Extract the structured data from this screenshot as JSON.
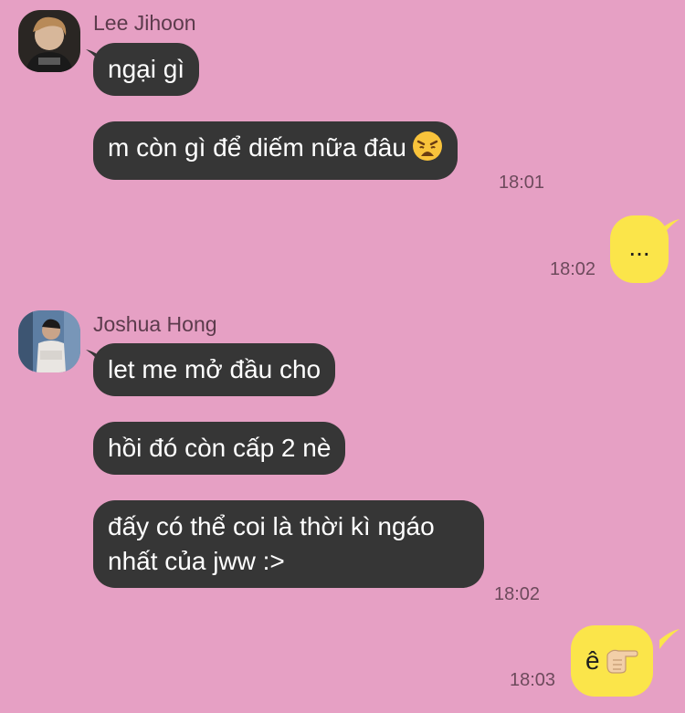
{
  "colors": {
    "background": "#e6a0c4",
    "incoming_bubble": "#363636",
    "outgoing_bubble": "#fbe54a"
  },
  "groups": [
    {
      "sender": "Lee Jihoon",
      "messages": [
        "ngại gì",
        "m còn gì để diếm nữa đâu"
      ],
      "time": "18:01",
      "emoji": "weary-face-icon"
    },
    {
      "outgoing": true,
      "messages": [
        "..."
      ],
      "time": "18:02"
    },
    {
      "sender": "Joshua Hong",
      "messages": [
        "let me mở đầu cho",
        "hồi đó còn cấp 2 nè",
        "đấy có thể coi là thời kì ngáo nhất của jww :>"
      ],
      "time": "18:02"
    },
    {
      "outgoing": true,
      "messages": [
        "ê"
      ],
      "time": "18:03",
      "emoji": "pointing-hand-icon"
    }
  ]
}
